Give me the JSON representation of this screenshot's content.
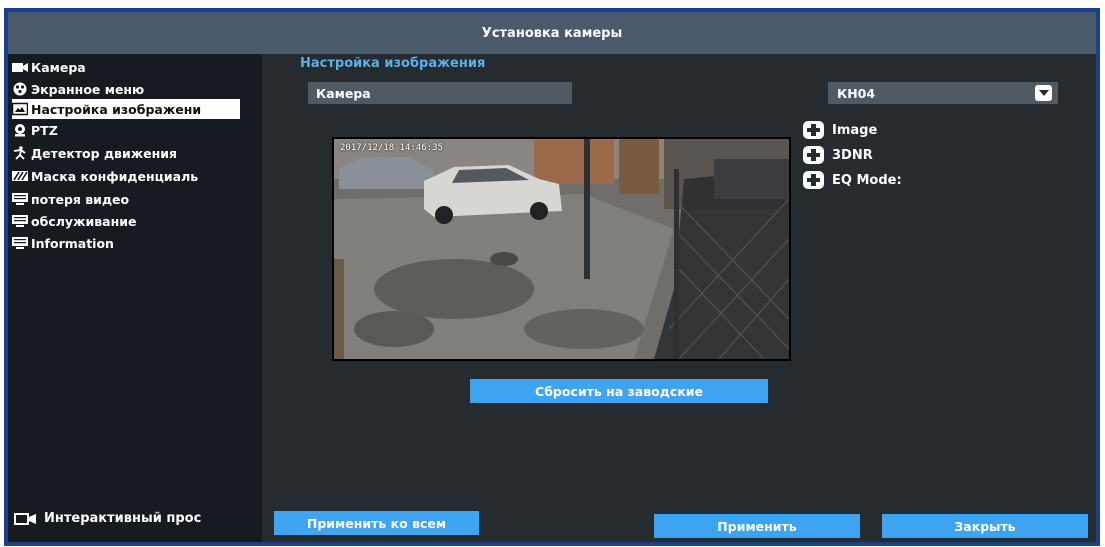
{
  "window": {
    "title": "Установка камеры"
  },
  "sidebar": {
    "items": [
      {
        "label": "Камера",
        "icon": "camera-icon"
      },
      {
        "label": "Экранное меню",
        "icon": "osd-icon"
      },
      {
        "label": "Настройка изображени",
        "icon": "image-icon",
        "active": true
      },
      {
        "label": "PTZ",
        "icon": "ptz-icon"
      },
      {
        "label": "Детектор движения",
        "icon": "motion-icon"
      },
      {
        "label": "Маска конфиденциаль",
        "icon": "mask-icon"
      },
      {
        "label": "потеря видео",
        "icon": "monitor-icon"
      },
      {
        "label": "обслуживание",
        "icon": "monitor-icon"
      },
      {
        "label": "Information",
        "icon": "monitor-icon"
      }
    ],
    "bottom_label": "Интерактивный прос"
  },
  "main": {
    "section_title": "Настройка изображения",
    "camera_label": "Камера",
    "camera_select": "КН04",
    "expanders": [
      {
        "label": "Image"
      },
      {
        "label": "3DNR"
      },
      {
        "label": "EQ Mode:"
      }
    ],
    "preview_timestamp": "2017/12/18 14:46:35",
    "reset_button": "Сбросить на заводские"
  },
  "footer": {
    "apply_all": "Применить ко всем",
    "apply": "Применить",
    "close": "Закрыть"
  },
  "colors": {
    "accent": "#3ea3f0",
    "section_title": "#5ab0e8",
    "frame": "#1b3d8a",
    "titlebar": "#4a5a6a",
    "sidebar_bg": "#161b22",
    "main_bg": "#262b30"
  }
}
